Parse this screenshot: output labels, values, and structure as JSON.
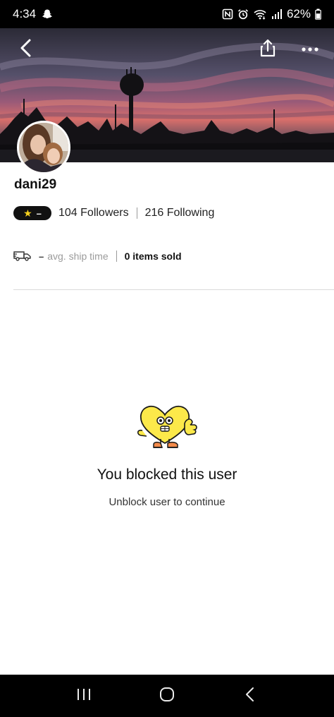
{
  "status_bar": {
    "time": "4:34",
    "battery": "62%",
    "icons": [
      "snapchat-icon",
      "nfc-icon",
      "alarm-icon",
      "wifi-icon",
      "signal-icon",
      "battery-icon"
    ]
  },
  "header": {
    "back_icon": "chevron-left-icon",
    "share_icon": "share-icon",
    "more_icon": "more-horizontal-icon"
  },
  "profile": {
    "username": "dani29",
    "rating": {
      "star_icon": "star-icon",
      "value": "–"
    },
    "followers": "104 Followers",
    "following": "216 Following",
    "shipping": {
      "truck_icon": "truck-icon",
      "value": "–",
      "label": "avg. ship time",
      "items_sold": "0 items sold"
    }
  },
  "empty_state": {
    "mascot_icon": "heart-mascot-icon",
    "title": "You blocked this user",
    "subtitle": "Unblock user to continue"
  },
  "nav_bar": {
    "icons": [
      "recent-apps-icon",
      "home-icon",
      "back-icon"
    ]
  },
  "colors": {
    "rating_pill": "#111111",
    "star": "#f7d21e",
    "divider": "#dadada",
    "muted_text": "#9b9b9b",
    "mascot_yellow": "#fce94a"
  }
}
